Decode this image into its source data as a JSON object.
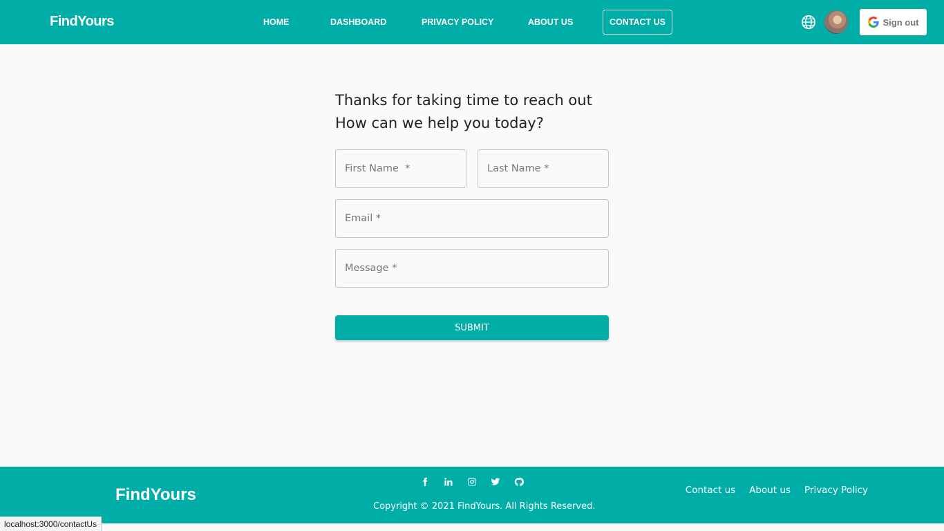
{
  "app": {
    "brand": "FindYours"
  },
  "nav": {
    "items": [
      {
        "label": "HOME"
      },
      {
        "label": "DASHBOARD"
      },
      {
        "label": "PRIVACY POLICY"
      },
      {
        "label": "ABOUT US"
      },
      {
        "label": "CONTACT US",
        "active": true
      }
    ],
    "language_icon": "globe-icon",
    "avatar_icon": "user-avatar",
    "signout_label": "Sign out",
    "signout_icon": "google-icon"
  },
  "form": {
    "heading_line1": "Thanks for taking time to reach out",
    "heading_line2": "How can we help you today?",
    "first_name_placeholder": "First Name  *",
    "last_name_placeholder": "Last Name *",
    "email_placeholder": "Email *",
    "message_placeholder": "Message *",
    "submit_label": "SUBMIT"
  },
  "footer": {
    "brand": "FindYours",
    "social_icons": [
      "facebook-icon",
      "linkedin-icon",
      "instagram-icon",
      "twitter-icon",
      "github-icon"
    ],
    "copyright": "Copyright © 2021 FindYours. All Rights Reserved.",
    "links": [
      "Contact us",
      "About us",
      "Privacy Policy"
    ]
  },
  "status_bar": {
    "url": "localhost:3000/contactUs"
  },
  "colors": {
    "primary": "#00ada7",
    "background": "#fafafa",
    "field_border": "#c4c4c4"
  }
}
